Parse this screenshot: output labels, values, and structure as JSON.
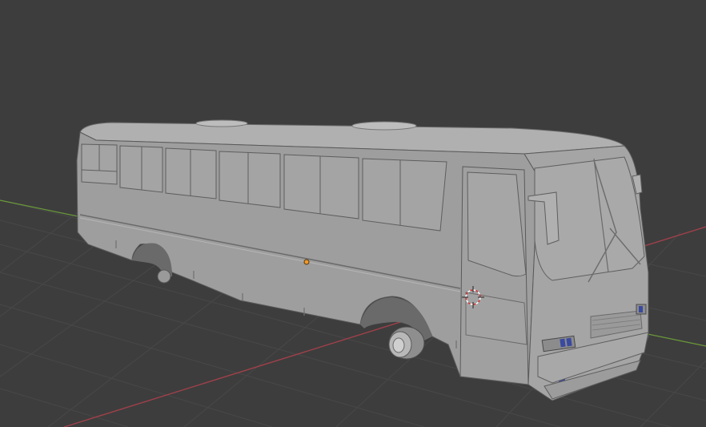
{
  "app": {
    "name": "",
    "view": "3d-viewport"
  },
  "scene": {
    "object": "bus-model",
    "shading": "solid",
    "show_grid": true,
    "show_x_axis": true,
    "show_y_axis": true
  },
  "colors": {
    "background": "#3d3d3d",
    "grid_line": "#484848",
    "x_axis": "#a0404a",
    "y_axis": "#6a9a3a",
    "mesh_body": "#9e9e9e",
    "mesh_shadow": "#8a8a8a",
    "mesh_highlight": "#b4b4b4",
    "outline": "#5a5a5a",
    "origin_dot": "#f09a2a",
    "cursor_red": "#d03030",
    "cursor_white": "#ffffff"
  },
  "icons": {
    "origin": "object-origin-icon",
    "cursor": "3d-cursor-icon"
  }
}
